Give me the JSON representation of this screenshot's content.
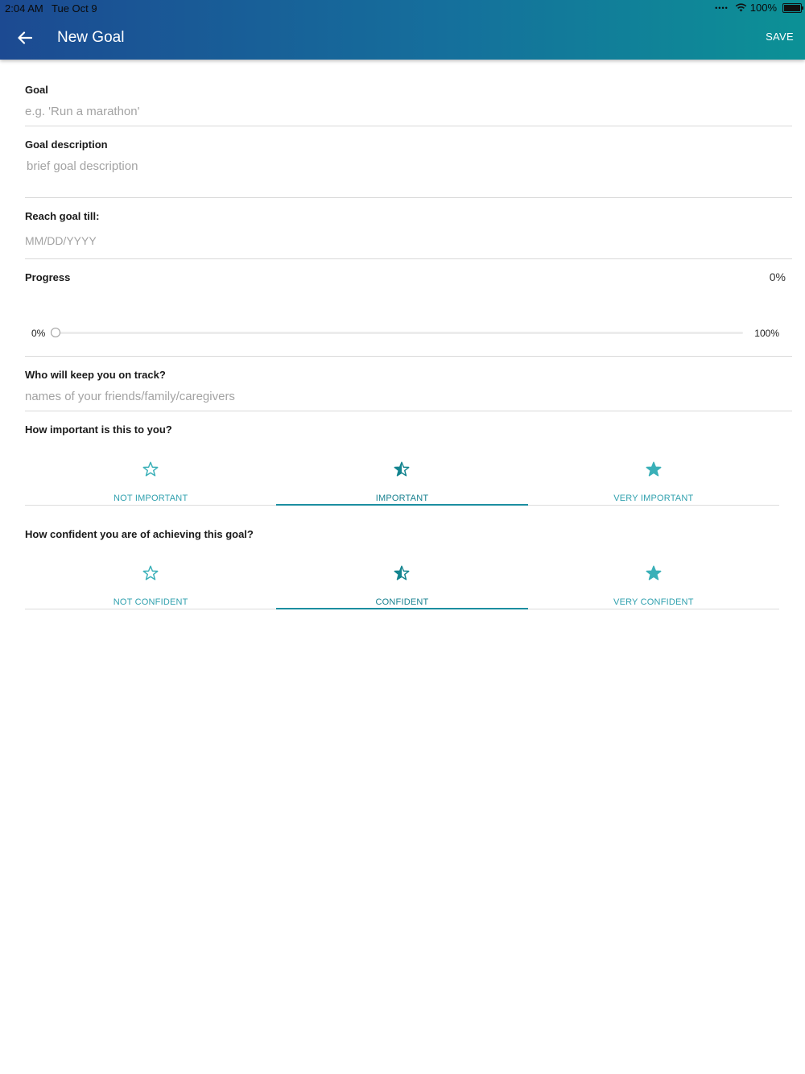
{
  "status_bar": {
    "time": "2:04 AM",
    "date": "Tue Oct 9",
    "battery": "100%"
  },
  "header": {
    "title": "New Goal",
    "save_label": "SAVE"
  },
  "goal": {
    "label": "Goal",
    "placeholder": "e.g. 'Run a marathon'"
  },
  "description": {
    "label": "Goal description",
    "placeholder": "brief goal description"
  },
  "deadline": {
    "label": "Reach goal till:",
    "placeholder": "MM/DD/YYYY"
  },
  "progress": {
    "label": "Progress",
    "value_text": "0%",
    "min_label": "0%",
    "max_label": "100%",
    "value": 0
  },
  "accountability": {
    "label": "Who will keep you on track?",
    "placeholder": "names of your friends/family/caregivers"
  },
  "importance": {
    "question": "How important is this to you?",
    "options": [
      "NOT IMPORTANT",
      "IMPORTANT",
      "VERY IMPORTANT"
    ],
    "selected": "IMPORTANT"
  },
  "confidence": {
    "question": "How confident you are of achieving this goal?",
    "options": [
      "NOT CONFIDENT",
      "CONFIDENT",
      "VERY CONFIDENT"
    ],
    "selected": "CONFIDENT"
  },
  "colors": {
    "accent": "#1b8ea0",
    "header_start": "#1c4a92",
    "header_end": "#0c9196"
  },
  "icons": {
    "back": "arrow-left-icon",
    "star_outline": "star-outline-icon",
    "star_half": "star-half-icon",
    "star_filled": "star-filled-icon"
  }
}
